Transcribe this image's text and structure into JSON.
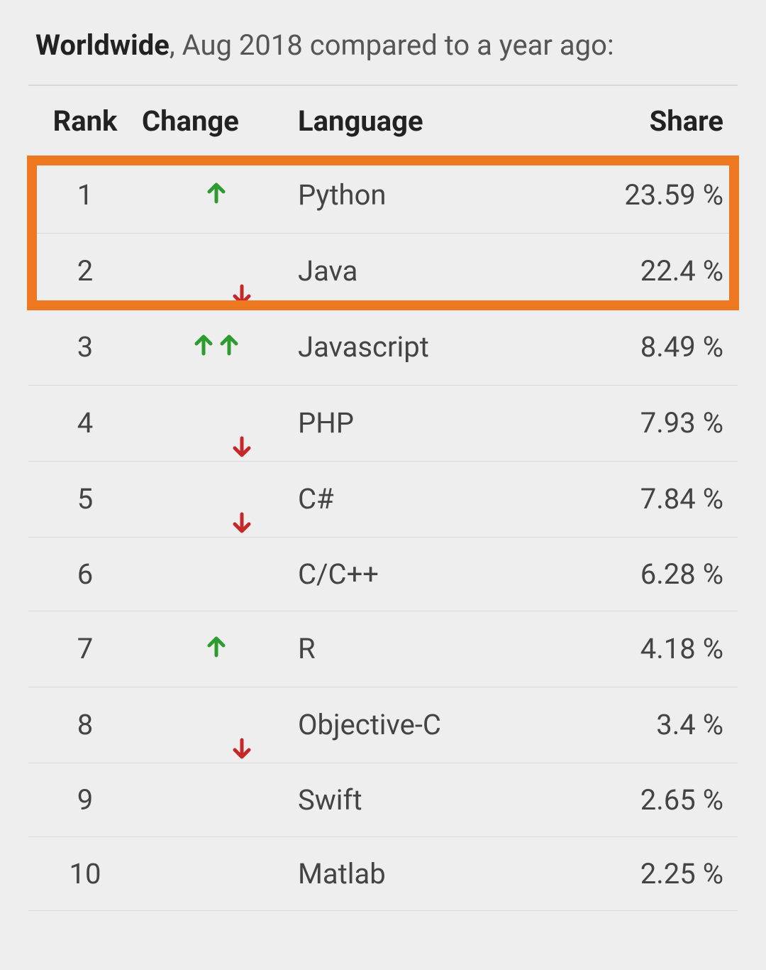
{
  "title": {
    "strong": "Worldwide",
    "rest": ", Aug 2018 compared to a year ago:"
  },
  "columns": {
    "rank": "Rank",
    "change": "Change",
    "language": "Language",
    "share": "Share"
  },
  "rows": [
    {
      "rank": "1",
      "change": "up",
      "language": "Python",
      "share": "23.59 %"
    },
    {
      "rank": "2",
      "change": "down",
      "language": "Java",
      "share": "22.4 %"
    },
    {
      "rank": "3",
      "change": "up2",
      "language": "Javascript",
      "share": "8.49 %"
    },
    {
      "rank": "4",
      "change": "down",
      "language": "PHP",
      "share": "7.93 %"
    },
    {
      "rank": "5",
      "change": "down",
      "language": "C#",
      "share": "7.84 %"
    },
    {
      "rank": "6",
      "change": "none",
      "language": "C/C++",
      "share": "6.28 %"
    },
    {
      "rank": "7",
      "change": "up",
      "language": "R",
      "share": "4.18 %"
    },
    {
      "rank": "8",
      "change": "down",
      "language": "Objective-C",
      "share": "3.4 %"
    },
    {
      "rank": "9",
      "change": "none",
      "language": "Swift",
      "share": "2.65 %"
    },
    {
      "rank": "10",
      "change": "none",
      "language": "Matlab",
      "share": "2.25 %"
    }
  ],
  "highlight": {
    "fromRow": 0,
    "toRow": 1
  },
  "chart_data": {
    "type": "table",
    "title": "Worldwide programming language popularity share, Aug 2018 vs a year ago",
    "columns": [
      "Rank",
      "Change",
      "Language",
      "Share %"
    ],
    "rows": [
      [
        1,
        "up",
        "Python",
        23.59
      ],
      [
        2,
        "down",
        "Java",
        22.4
      ],
      [
        3,
        "up2",
        "Javascript",
        8.49
      ],
      [
        4,
        "down",
        "PHP",
        7.93
      ],
      [
        5,
        "down",
        "C#",
        7.84
      ],
      [
        6,
        "none",
        "C/C++",
        6.28
      ],
      [
        7,
        "up",
        "R",
        4.18
      ],
      [
        8,
        "down",
        "Objective-C",
        3.4
      ],
      [
        9,
        "none",
        "Swift",
        2.65
      ],
      [
        10,
        "none",
        "Matlab",
        2.25
      ]
    ]
  }
}
